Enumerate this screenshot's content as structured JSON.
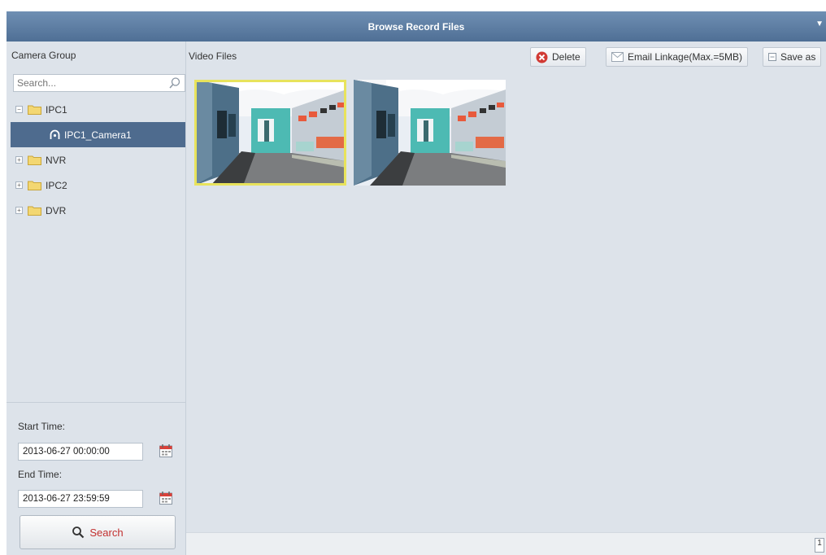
{
  "window": {
    "title": "Browse Record Files"
  },
  "sidebar": {
    "header": "Camera Group",
    "search_placeholder": "Search...",
    "tree": [
      {
        "label": "IPC1",
        "toggle": "−"
      },
      {
        "label": "IPC1_Camera1"
      },
      {
        "label": "NVR",
        "toggle": "+"
      },
      {
        "label": "IPC2",
        "toggle": "+"
      },
      {
        "label": "DVR",
        "toggle": "+"
      }
    ],
    "start_time_label": "Start Time:",
    "start_time_value": "2013-06-27 00:00:00",
    "end_time_label": "End Time:",
    "end_time_value": "2013-06-27 23:59:59",
    "search_button": "Search"
  },
  "main": {
    "header": "Video Files",
    "toolbar": {
      "delete_label": "Delete",
      "email_label": "Email Linkage(Max.=5MB)",
      "save_label": "Save as"
    },
    "page_indicator": "1"
  },
  "colors": {
    "title_bar": "#5a7aa0",
    "panel_bg": "#dde3ea",
    "selected_row": "#4e6b8e",
    "thumb_highlight": "#e8e35c",
    "search_text": "#c2302f"
  }
}
